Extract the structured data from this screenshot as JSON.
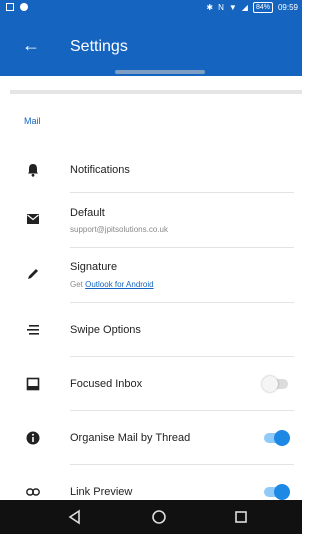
{
  "status_bar": {
    "time": "09:59",
    "battery": "84%"
  },
  "app_bar": {
    "title": "Settings"
  },
  "section_header": "Mail",
  "items": [
    {
      "label": "Notifications"
    },
    {
      "label": "Default",
      "sub": "support@jpitsolutions.co.uk"
    },
    {
      "label": "Signature",
      "sub_prefix": "Get ",
      "sub_link": "Outlook for Android"
    },
    {
      "label": "Swipe Options"
    },
    {
      "label": "Focused Inbox",
      "toggle": false
    },
    {
      "label": "Organise Mail by Thread",
      "toggle": true
    },
    {
      "label": "Link Preview",
      "toggle": true
    }
  ],
  "colors": {
    "accent": "#1565c0",
    "toggle_on": "#1e88e5"
  }
}
